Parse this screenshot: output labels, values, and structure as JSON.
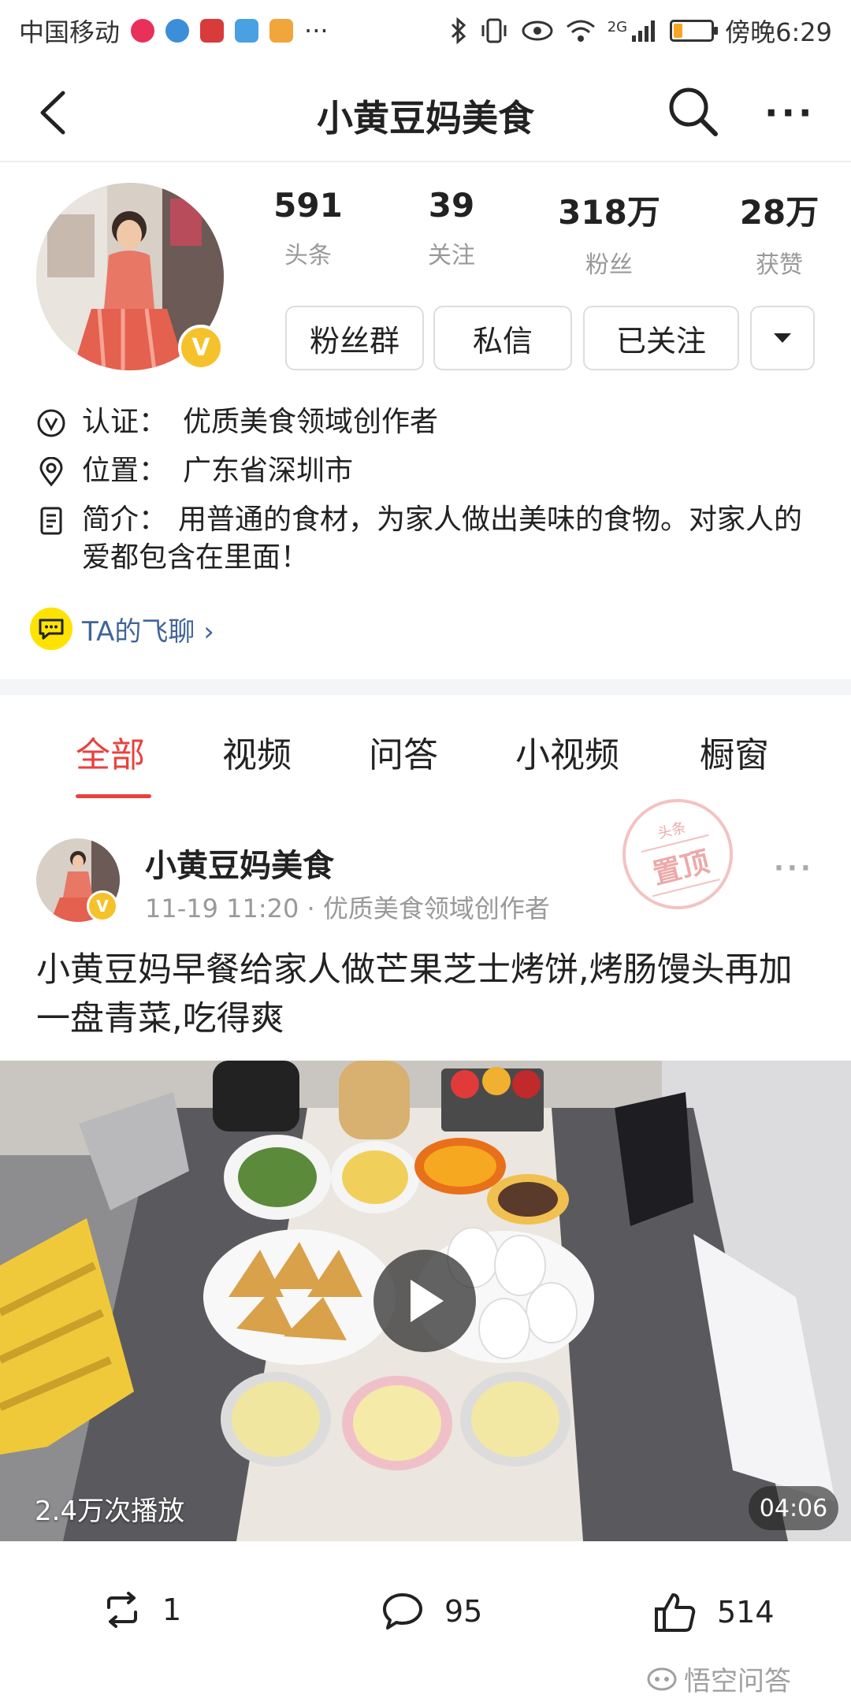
{
  "status_bar": {
    "carrier": "中国移动",
    "network": "2G",
    "time": "傍晚6:29",
    "more": "···",
    "battery_level": 0.22,
    "app_icon_colors": [
      "#e8305a",
      "#3b8fd8",
      "#d93a3a",
      "#4aa0e0",
      "#f0a63c"
    ]
  },
  "nav": {
    "title": "小黄豆妈美食",
    "more": "···"
  },
  "profile": {
    "badge": "V",
    "stats": [
      {
        "value": "591",
        "label": "头条"
      },
      {
        "value": "39",
        "label": "关注"
      },
      {
        "value": "318万",
        "label": "粉丝"
      },
      {
        "value": "28万",
        "label": "获赞"
      }
    ],
    "buttons": {
      "fans_group": "粉丝群",
      "message": "私信",
      "followed": "已关注"
    },
    "certification": {
      "label": "认证：",
      "value": "优质美食领域创作者"
    },
    "location": {
      "label": "位置：",
      "value": "广东省深圳市"
    },
    "intro": {
      "label": "简介：",
      "value": "用普通的食材，为家人做出美味的食物。对家人的爱都包含在里面！"
    },
    "feiliao": "TA的飞聊 ›"
  },
  "tabs": [
    {
      "label": "全部",
      "active": true
    },
    {
      "label": "视频",
      "active": false
    },
    {
      "label": "问答",
      "active": false
    },
    {
      "label": "小视频",
      "active": false
    },
    {
      "label": "橱窗",
      "active": false
    }
  ],
  "post": {
    "author": "小黄豆妈美食",
    "meta": "11-19 11:20 · 优质美食领域创作者",
    "pinned_small": "头条",
    "pinned": "置顶",
    "title": "小黄豆妈早餐给家人做芒果芝士烤饼,烤肠馒头再加一盘青菜,吃得爽",
    "video": {
      "play_count": "2.4万次播放",
      "duration": "04:06"
    },
    "actions": {
      "repost": "1",
      "comments": "95",
      "likes": "514"
    },
    "more": "···"
  },
  "watermark": "悟空问答",
  "colors": {
    "accent": "#e8423e",
    "badge": "#f6c22b",
    "link": "#406599",
    "feiliao_bg": "#ffe300"
  }
}
